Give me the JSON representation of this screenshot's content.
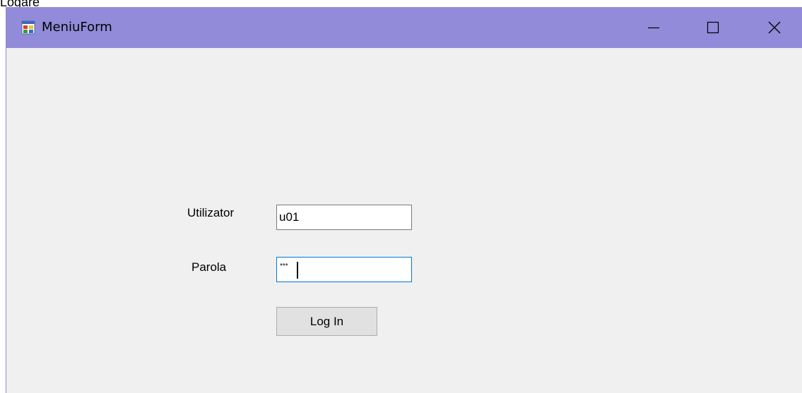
{
  "caption_above": "Logare",
  "window": {
    "title": "MeniuForm",
    "icon": "winforms-app-icon",
    "controls": [
      "minimize-icon",
      "maximize-icon",
      "close-icon"
    ],
    "titlebar_color": "#918bd9",
    "background_color": "#f0f0f0"
  },
  "form": {
    "user_label": "Utilizator",
    "user_value": "u01",
    "password_label": "Parola",
    "password_value": "***",
    "login_button": "Log In"
  }
}
